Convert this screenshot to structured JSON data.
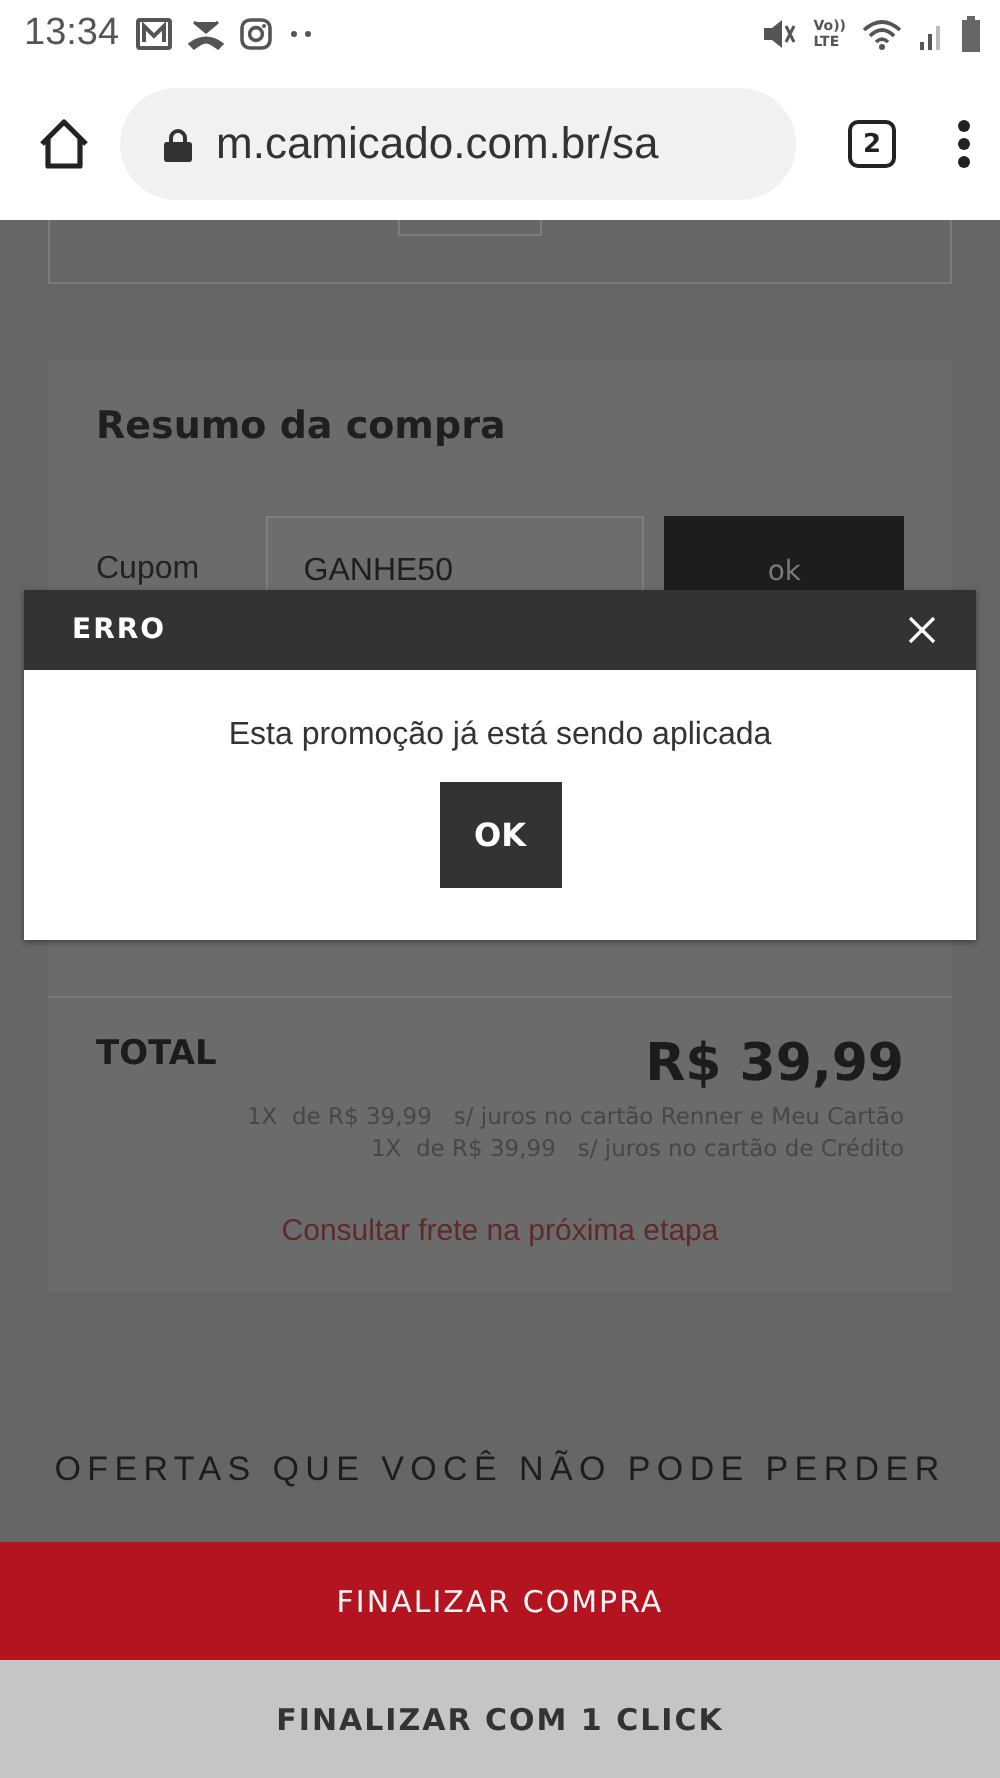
{
  "status_bar": {
    "time": "13:34",
    "network_label": "Vo))\nLTE"
  },
  "browser": {
    "url": "m.camicado.com.br/sa",
    "tab_count": "2"
  },
  "summary": {
    "title": "Resumo da compra",
    "coupon_label": "Cupom",
    "coupon_value": "GANHE50",
    "coupon_button": "ok",
    "total_label": "TOTAL",
    "total_value": "R$ 39,99",
    "installments": [
      {
        "times": "1X",
        "amount": "de R$ 39,99",
        "terms": "s/ juros no cartão Renner e Meu Cartão"
      },
      {
        "times": "1X",
        "amount": "de R$ 39,99",
        "terms": "s/ juros no cartão de Crédito"
      }
    ],
    "shipping_link": "Consultar frete na próxima etapa"
  },
  "offers_heading": "OFERTAS QUE VOCÊ NÃO PODE PERDER",
  "dialog": {
    "title": "ERRO",
    "message": "Esta promoção já está sendo aplicada",
    "button": "OK"
  },
  "actions": [
    {
      "label": "FINALIZAR COMPRA",
      "kind": "primary"
    },
    {
      "label": "FINALIZAR COM 1 CLICK",
      "kind": "secondary"
    }
  ]
}
